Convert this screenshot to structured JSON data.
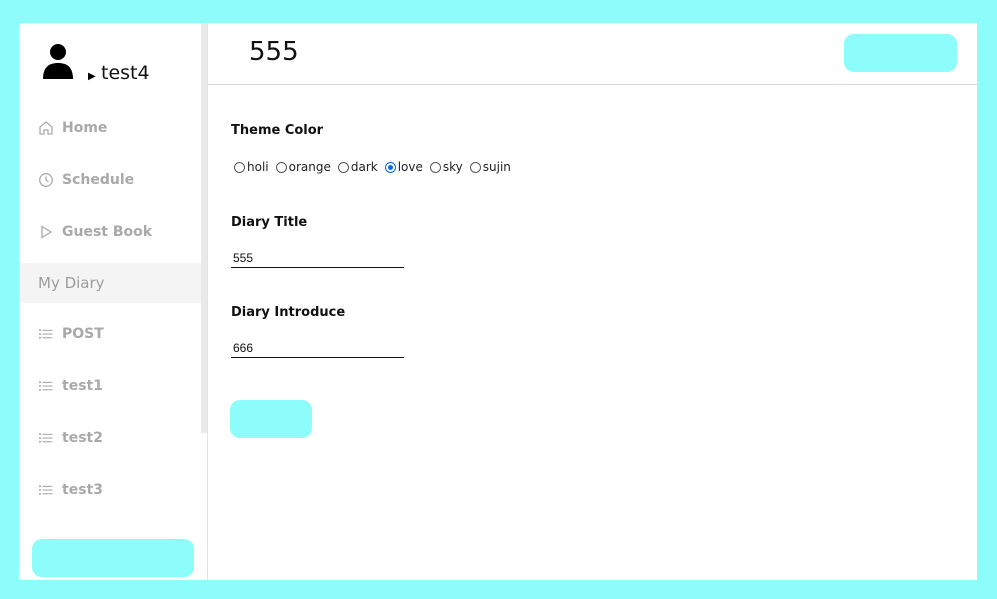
{
  "profile": {
    "username": "test4"
  },
  "header": {
    "title": "555"
  },
  "nav": {
    "items": [
      {
        "label": "Home",
        "icon": "home-icon"
      },
      {
        "label": "Schedule",
        "icon": "clock-icon"
      },
      {
        "label": "Guest Book",
        "icon": "play-icon"
      },
      {
        "label": "My Diary",
        "icon": ""
      },
      {
        "label": "POST",
        "icon": "list-icon"
      },
      {
        "label": "test1",
        "icon": "list-icon"
      },
      {
        "label": "test2",
        "icon": "list-icon"
      },
      {
        "label": "test3",
        "icon": "list-icon"
      }
    ],
    "active": "My Diary"
  },
  "form": {
    "theme_label": "Theme Color",
    "theme_options": [
      "holi",
      "orange",
      "dark",
      "love",
      "sky",
      "sujin"
    ],
    "theme_selected": "love",
    "title_label": "Diary Title",
    "title_value": "555",
    "intro_label": "Diary Introduce",
    "intro_value": "666"
  },
  "colors": {
    "accent": "#8cfdfb",
    "radio_selected": "#0a6be0"
  }
}
